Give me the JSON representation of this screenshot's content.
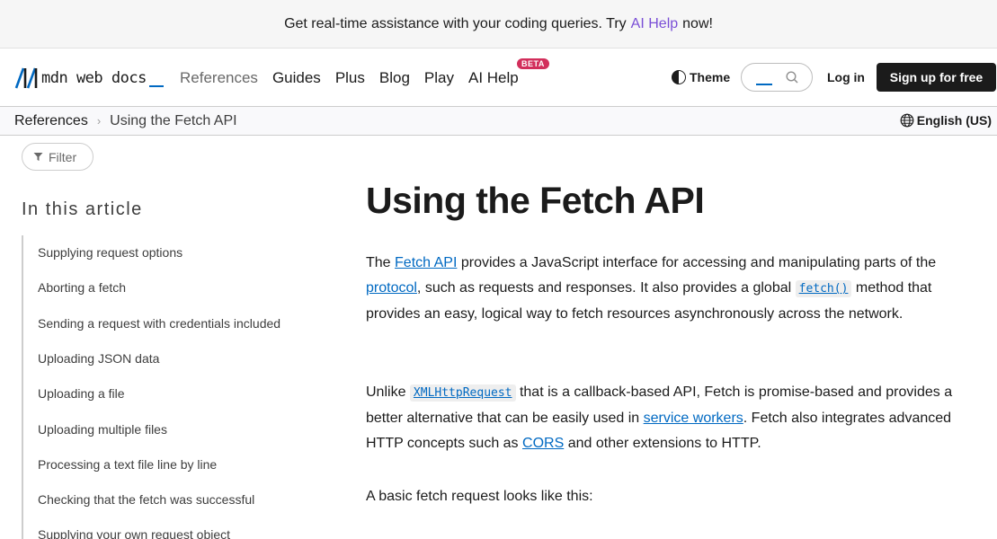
{
  "banner": {
    "text_before": "Get real-time assistance with your coding queries. Try",
    "link": "AI Help",
    "text_after": "now!"
  },
  "header": {
    "logo_text": "mdn web docs",
    "nav": [
      "References",
      "Guides",
      "Plus",
      "Blog",
      "Play",
      "AI Help"
    ],
    "beta_badge": "BETA",
    "theme_label": "Theme",
    "login_label": "Log in",
    "signup_label": "Sign up for free"
  },
  "breadcrumb": {
    "items": [
      "References",
      "Using the Fetch API"
    ],
    "language": "English (US)"
  },
  "sidebar": {
    "filter_label": "Filter",
    "toc_title": "In this article",
    "toc_items": [
      "Supplying request options",
      "Aborting a fetch",
      "Sending a request with credentials included",
      "Uploading JSON data",
      "Uploading a file",
      "Uploading multiple files",
      "Processing a text file line by line",
      "Checking that the fetch was successful",
      "Supplying your own request object"
    ]
  },
  "article": {
    "title": "Using the Fetch API",
    "p1": {
      "t1": "The",
      "link1": "Fetch API",
      "t2": "provides a JavaScript interface for accessing and manipulating parts of the",
      "link2": "protocol",
      "t3": ", such as requests and responses. It also provides a global",
      "code1": "fetch()",
      "t4": "method that provides an easy, logical way to fetch resources asynchronously across the network."
    },
    "p2": {
      "t1": "Unlike",
      "code1": "XMLHttpRequest",
      "t2": "that is a callback-based API, Fetch is promise-based and provides a better alternative that can be easily used in",
      "link1": "service workers",
      "t3": ". Fetch also integrates advanced HTTP concepts such as",
      "link2": "CORS",
      "t4": "and other extensions to HTTP."
    },
    "p3": "A basic fetch request looks like this:"
  },
  "colors": {
    "link": "#0069c2",
    "ai_help": "#7a4fd6",
    "beta": "#d22e5b",
    "signup_bg": "#1b1b1b"
  }
}
